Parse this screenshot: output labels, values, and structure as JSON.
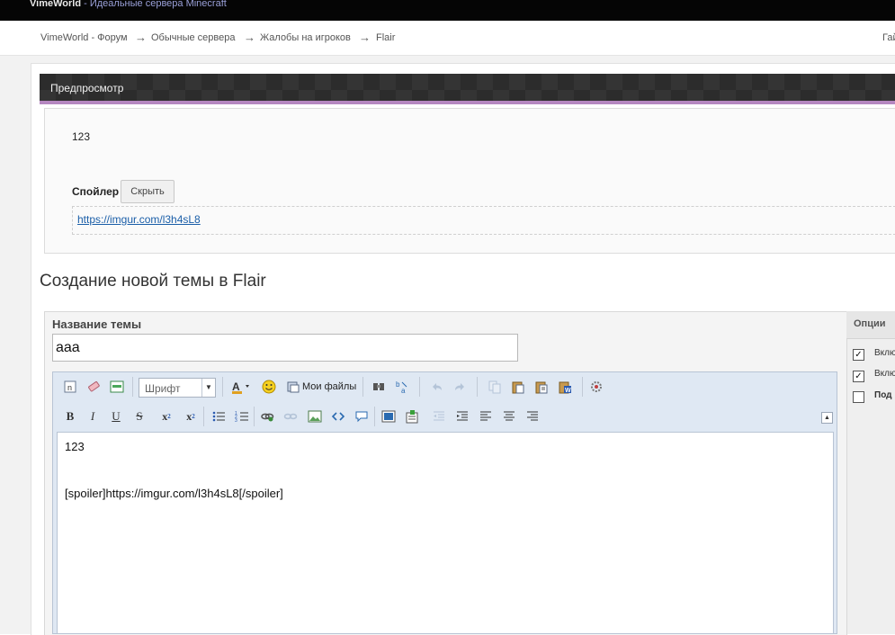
{
  "topbar": {
    "brand": "VimeWorld",
    "separator": " - ",
    "tagline": "Идеальные сервера Minecraft"
  },
  "breadcrumb": {
    "items": [
      "VimeWorld - Форум",
      "Обычные сервера",
      "Жалобы на игроков",
      "Flair"
    ],
    "arrow": "→",
    "right_text": "Гай"
  },
  "preview": {
    "title": "Предпросмотр",
    "text": "123",
    "spoiler_label": "Спойлер",
    "spoiler_button": "Скрыть",
    "spoiler_link": "https://imgur.com/l3h4sL8"
  },
  "page_heading": "Создание новой темы в Flair",
  "form": {
    "title_label": "Название темы",
    "title_value": "aaa"
  },
  "editor": {
    "font_select": "Шрифт",
    "my_files": "Мои файлы",
    "content_line1": "123",
    "content_line2": "[spoiler]https://imgur.com/l3h4sL8[/spoiler]"
  },
  "options": {
    "title": "Опции",
    "items": [
      {
        "label": "Вклю",
        "checked": true,
        "bold": false
      },
      {
        "label": "Вклю",
        "checked": true,
        "bold": false
      },
      {
        "label": "Под",
        "checked": false,
        "bold": true
      }
    ]
  },
  "colors": {
    "accent": "#b587c0",
    "link": "#1a5ea8",
    "topbar": "#050505"
  }
}
